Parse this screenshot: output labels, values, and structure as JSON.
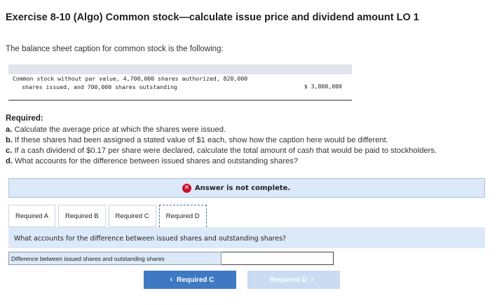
{
  "exercise": {
    "title": "Exercise 8-10 (Algo) Common stock—calculate issue price and dividend amount LO 1",
    "intro": "The balance sheet caption for common stock is the following:"
  },
  "balance_sheet": {
    "line1": "Common stock without par value, 4,700,000 shares authorized, 820,000",
    "line2": "shares issued, and 700,000 shares outstanding",
    "amount": "$ 3,800,000"
  },
  "required": {
    "heading": "Required:",
    "a_prefix": "a.",
    "a_text": " Calculate the average price at which the shares were issued.",
    "b_prefix": "b.",
    "b_text": " If these shares had been assigned a stated value of $1 each, show how the caption here would be different.",
    "c_prefix": "c.",
    "c_text": " If a cash dividend of $0.17 per share were declared, calculate the total amount of cash that would be paid to stockholders.",
    "d_prefix": "d.",
    "d_text": " What accounts for the difference between issued shares and outstanding shares?"
  },
  "status": {
    "icon": "x-circle-icon",
    "icon_glyph": "✕",
    "text": "Answer is not complete.",
    "color": "#c8102e"
  },
  "tabs": [
    {
      "label": "Required A"
    },
    {
      "label": "Required B"
    },
    {
      "label": "Required C"
    },
    {
      "label": "Required D"
    }
  ],
  "active_tab": "Required D",
  "question": "What accounts for the difference between issued shares and outstanding shares?",
  "answer": {
    "label": "Difference between issued shares and outstanding shares",
    "value": ""
  },
  "nav": {
    "prev_label": "Required C",
    "next_label": "Required D",
    "prev_glyph": "‹",
    "next_glyph": "›"
  },
  "colors": {
    "accent": "#3f79c4",
    "accent_disabled": "#c9dcf2",
    "panel": "#dbe9f8"
  }
}
